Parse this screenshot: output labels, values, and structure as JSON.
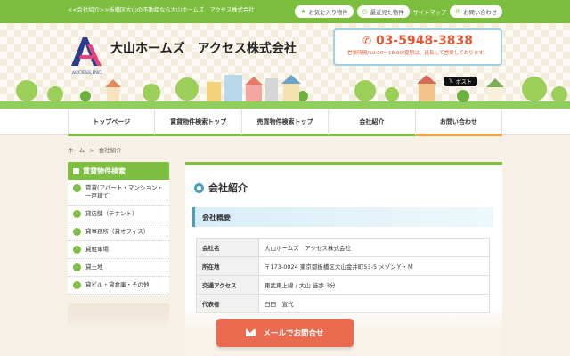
{
  "topbar": {
    "breadcrumb": "<<会社紹介>>板橋区大山の不動産なら大山ホームズ　アクセス株式会社",
    "favorites": "お気に入り物件",
    "recent": "最近見た物件",
    "sitemap": "サイトマップ",
    "contact": "お問い合わせ"
  },
  "header": {
    "logo_text": "ACCESS,INC.",
    "company": "大山ホームズ　アクセス株式会社",
    "phone": "03-5948-3838",
    "hours": "営業時間/10:00～18:00/夏期は、延長して営業しております。",
    "post_label": "ポスト"
  },
  "nav": [
    {
      "label": "トップページ"
    },
    {
      "label": "賃貸物件検索トップ"
    },
    {
      "label": "売買物件検索トップ"
    },
    {
      "label": "会社紹介"
    },
    {
      "label": "お問い合わせ"
    }
  ],
  "breadcrumb": {
    "home": "ホーム",
    "sep": ">",
    "current": "会社紹介"
  },
  "sidebar": {
    "title": "賃貸物件検索",
    "items": [
      {
        "label": "賃貸(アパート・マンション・一戸建て)"
      },
      {
        "label": "貸店舗（テナント）"
      },
      {
        "label": "貸事務所（貸オフィス）"
      },
      {
        "label": "貸駐車場"
      },
      {
        "label": "貸土地"
      },
      {
        "label": "貸ビル・貸倉庫・その他"
      }
    ]
  },
  "main": {
    "title": "会社紹介",
    "section": "会社概要",
    "rows": [
      {
        "key": "会社名",
        "value": "大山ホームズ　アクセス株式会社"
      },
      {
        "key": "所在地",
        "value": "〒173-0024 東京都板橋区大山金井町53-5 メゾンＹ・Ｍ"
      },
      {
        "key": "交通アクセス",
        "value": "東武東上線 / 大山 徒歩 3分"
      },
      {
        "key": "代表者",
        "value": "臼田　宣代"
      }
    ]
  },
  "mail_button": "メールでお問合せ",
  "colors": {
    "green": "#7cbf3f",
    "orange": "#ea6b4f",
    "blue": "#4a9ec4"
  }
}
